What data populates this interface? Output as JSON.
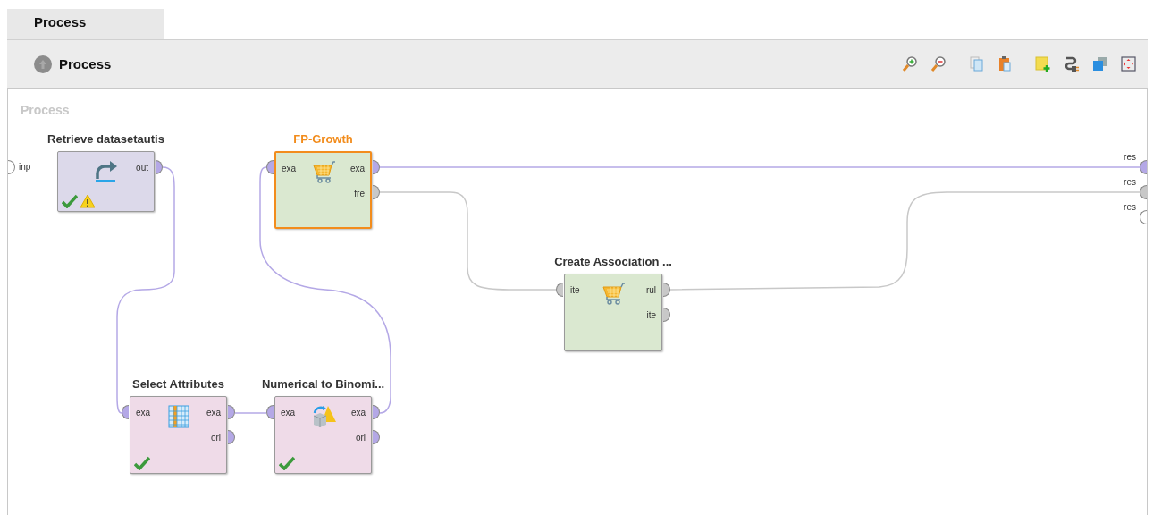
{
  "tabs": [
    {
      "label": "Process",
      "selected": true
    }
  ],
  "breadcrumb": {
    "label": "Process"
  },
  "toolbar": [
    {
      "kind": "zoom-in"
    },
    {
      "kind": "zoom-out"
    },
    {
      "kind": "copy"
    },
    {
      "kind": "paste"
    },
    {
      "kind": "note"
    },
    {
      "kind": "plug"
    },
    {
      "kind": "layers"
    },
    {
      "kind": "fit"
    }
  ],
  "canvas": {
    "title": "Process",
    "inputs": [
      {
        "label": "inp",
        "color": "#ffffff"
      }
    ],
    "outputs": [
      {
        "label": "res",
        "color": "#b4a8e6"
      },
      {
        "label": "res",
        "color": "#c8c8c8"
      },
      {
        "label": "res",
        "color": "#ffffff"
      }
    ],
    "operators": [
      {
        "title": "Retrieve datasetautis",
        "kind": "retrieve",
        "selected": false,
        "color": "#dcd9ea",
        "ok": true,
        "warning": true,
        "outputs": [
          {
            "label": "out",
            "color": "#b4a8e6"
          }
        ]
      },
      {
        "title": "FP-Growth",
        "kind": "cart",
        "selected": true,
        "color": "#dae8d0",
        "inputs": [
          {
            "label": "exa",
            "color": "#b4a8e6"
          }
        ],
        "outputs": [
          {
            "label": "exa",
            "color": "#b4a8e6"
          },
          {
            "label": "fre",
            "color": "#c8c8c8"
          }
        ]
      },
      {
        "title": "Create Association ...",
        "kind": "cart",
        "selected": false,
        "color": "#dae8d0",
        "inputs": [
          {
            "label": "ite",
            "color": "#c8c8c8"
          }
        ],
        "outputs": [
          {
            "label": "rul",
            "color": "#c8c8c8"
          },
          {
            "label": "ite",
            "color": "#c8c8c8"
          }
        ]
      },
      {
        "title": "Select Attributes",
        "kind": "table",
        "selected": false,
        "color": "#efdbe8",
        "ok": true,
        "inputs": [
          {
            "label": "exa",
            "color": "#b4a8e6"
          }
        ],
        "outputs": [
          {
            "label": "exa",
            "color": "#b4a8e6"
          },
          {
            "label": "ori",
            "color": "#b4a8e6"
          }
        ]
      },
      {
        "title": "Numerical to Binomi...",
        "kind": "convert",
        "selected": false,
        "color": "#efdbe8",
        "ok": true,
        "inputs": [
          {
            "label": "exa",
            "color": "#b4a8e6"
          }
        ],
        "outputs": [
          {
            "label": "exa",
            "color": "#b4a8e6"
          },
          {
            "label": "ori",
            "color": "#b4a8e6"
          }
        ]
      }
    ]
  }
}
